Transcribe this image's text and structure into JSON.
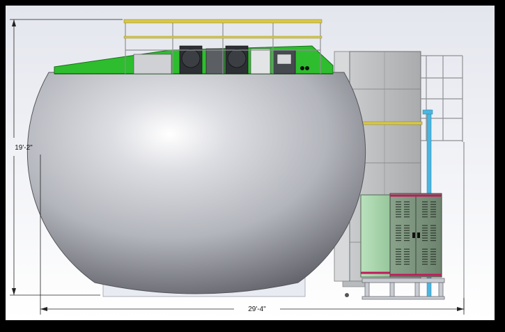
{
  "dimensions": {
    "height_label": "19'-2\"",
    "width_label": "29'-4\""
  },
  "colors": {
    "background_top": "#e6e8ef",
    "background_bottom": "#ffffff",
    "sphere_light": "#ffffff",
    "sphere_mid": "#c3c5cc",
    "sphere_dark": "#6f7078",
    "deck_green": "#2ebd2e",
    "railing_yellow": "#d8c84a",
    "tower_gray": "#b4b6b8",
    "cabinet_green": "#a9d7ad",
    "cabinet_dark_green": "#7f9780",
    "pipe_blue": "#4ab6e0",
    "base_magenta": "#c2185b"
  },
  "components": [
    {
      "name": "spherical-tank"
    },
    {
      "name": "top-deck-platform"
    },
    {
      "name": "deck-railing"
    },
    {
      "name": "equipment-tower"
    },
    {
      "name": "side-ladder-cage"
    },
    {
      "name": "electrical-cabinet"
    },
    {
      "name": "ventilated-cabinet"
    }
  ]
}
